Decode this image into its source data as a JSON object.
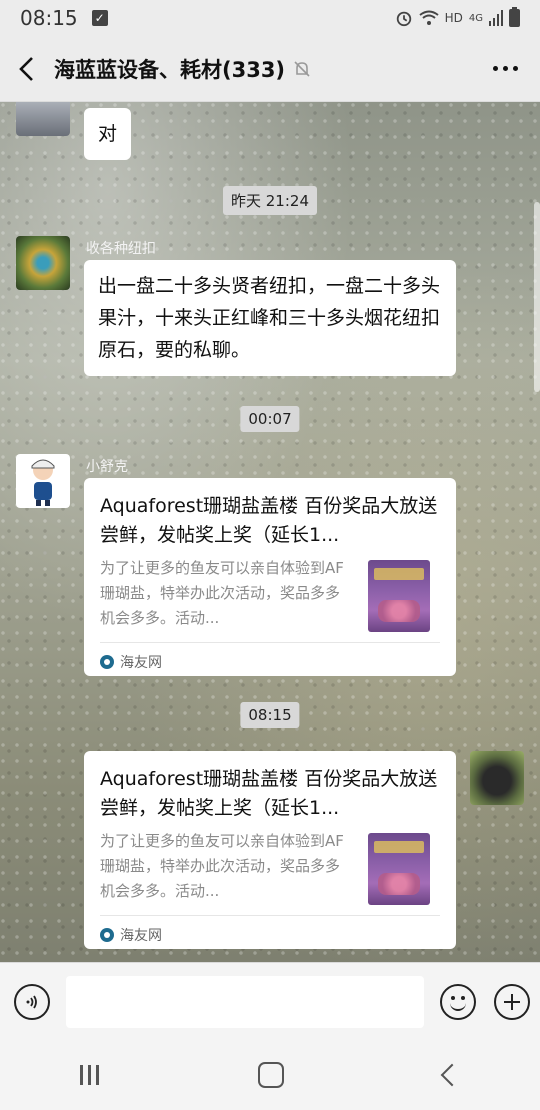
{
  "status": {
    "time": "08:15",
    "network": "HD",
    "signal": "4G"
  },
  "header": {
    "title": "海蓝蓝设备、耗材(333)"
  },
  "chat": {
    "messages": [
      {
        "type": "text",
        "text": "对"
      },
      {
        "type": "timestamp",
        "text": "昨天 21:24"
      },
      {
        "type": "text",
        "sender": "收各种纽扣",
        "text": "出一盘二十多头贤者纽扣，一盘二十多头果汁，十来头正红峰和三十多头烟花纽扣原石，要的私聊。"
      },
      {
        "type": "timestamp",
        "text": "00:07"
      },
      {
        "type": "card",
        "sender": "小舒克",
        "title": "Aquaforest珊瑚盐盖楼 百份奖品大放送尝鲜，发帖奖上奖（延长1...",
        "desc": "为了让更多的鱼友可以亲自体验到AF珊瑚盐，特举办此次活动，奖品多多机会多多。活动...",
        "source": "海友网"
      },
      {
        "type": "timestamp",
        "text": "08:15"
      },
      {
        "type": "card",
        "title": "Aquaforest珊瑚盐盖楼 百份奖品大放送尝鲜，发帖奖上奖（延长1...",
        "desc": "为了让更多的鱼友可以亲自体验到AF珊瑚盐，特举办此次活动，奖品多多机会多多。活动...",
        "source": "海友网"
      }
    ]
  },
  "colors": {
    "bubble": "#ffffff",
    "timestamp_bg": "#d8d8d8",
    "header_bg": "#ececec"
  }
}
